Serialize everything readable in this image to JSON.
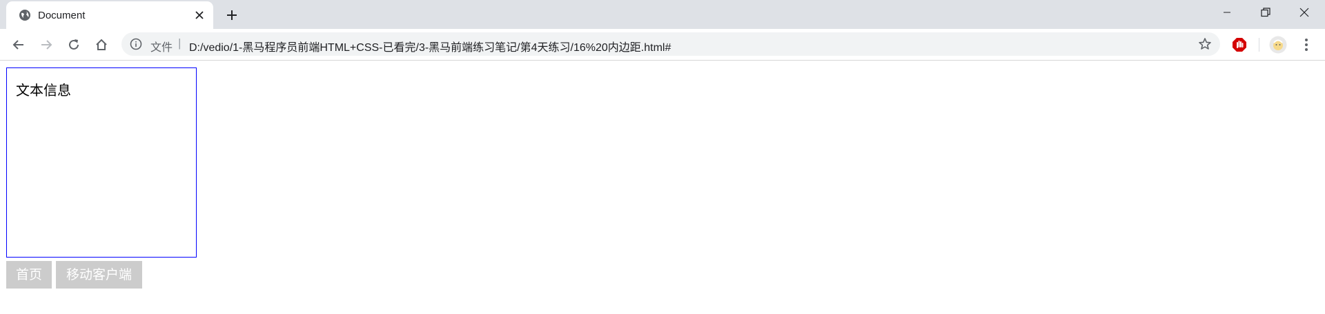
{
  "browser": {
    "tab": {
      "title": "Document"
    },
    "address_bar": {
      "scheme_label": "文件",
      "separator": "|",
      "url": "D:/vedio/1-黑马程序员前端HTML+CSS-已看完/3-黑马前端练习笔记/第4天练习/16%20内边距.html#"
    },
    "icons": {
      "favicon": "globe-icon",
      "tab_close": "close-icon",
      "new_tab": "plus-icon",
      "back": "back-arrow-icon",
      "forward": "forward-arrow-icon",
      "reload": "reload-icon",
      "home": "home-icon",
      "info": "info-icon",
      "bookmark": "star-icon",
      "extension": "adblock-hand-icon",
      "profile": "avatar-icon",
      "menu": "kebab-menu-icon",
      "minimize": "minimize-icon",
      "restore": "restore-icon",
      "close_window": "close-window-icon"
    }
  },
  "page": {
    "box_text": "文本信息",
    "links": [
      {
        "label": "首页"
      },
      {
        "label": "移动客户端"
      }
    ],
    "colors": {
      "box_border": "#0000ff",
      "link_bg": "#cccccc",
      "link_text": "#ffffff"
    }
  }
}
